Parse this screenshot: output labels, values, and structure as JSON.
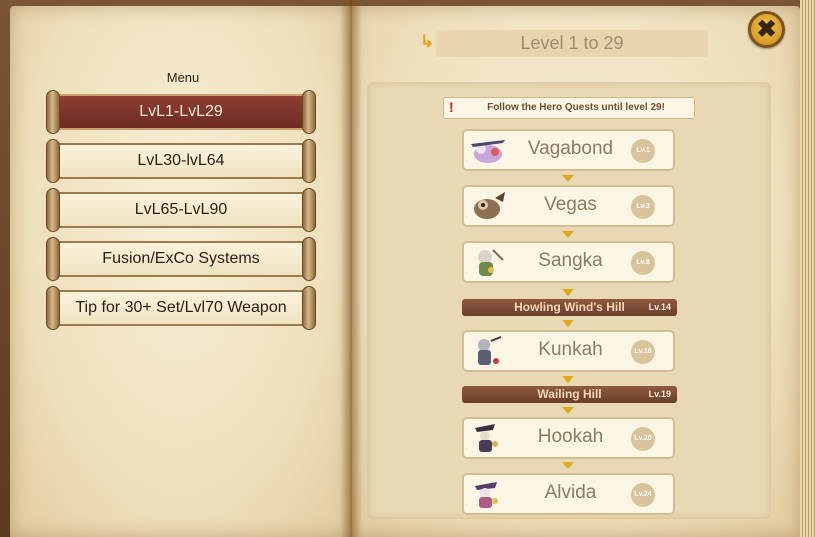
{
  "menu": {
    "title": "Menu",
    "items": [
      {
        "label": "LvL1-LvL29",
        "active": true
      },
      {
        "label": "LvL30-lvL64",
        "active": false
      },
      {
        "label": "LvL65-LvL90",
        "active": false
      },
      {
        "label": "Fusion/ExCo Systems",
        "active": false
      },
      {
        "label": "Tip for 30+ Set/Lvl70 Weapon",
        "active": false
      }
    ]
  },
  "header": {
    "arrow_icon": "↳",
    "title": "Level 1 to 29",
    "close_icon": "✖"
  },
  "notice": {
    "icon": "!",
    "text": "Follow the Hero Quests until level 29!"
  },
  "quests": [
    {
      "name": "Vagabond",
      "level": "Lv.1"
    },
    {
      "name": "Vegas",
      "level": "Lv.3"
    },
    {
      "name": "Sangka",
      "level": "Lv.8"
    },
    {
      "name": "Kunkah",
      "level": "Lv.16"
    },
    {
      "name": "Hookah",
      "level": "Lv.20"
    },
    {
      "name": "Alvida",
      "level": "Lv.24"
    }
  ],
  "maps": [
    {
      "name": "Howling Wind's Hill",
      "level": "Lv.14"
    },
    {
      "name": "Wailing Hill",
      "level": "Lv.19"
    }
  ],
  "colors": {
    "active_menu": "#7a3229",
    "accent_arrow": "#e0a81c",
    "map_bar": "#7a4a33",
    "notice_icon": "#d11a1a"
  }
}
